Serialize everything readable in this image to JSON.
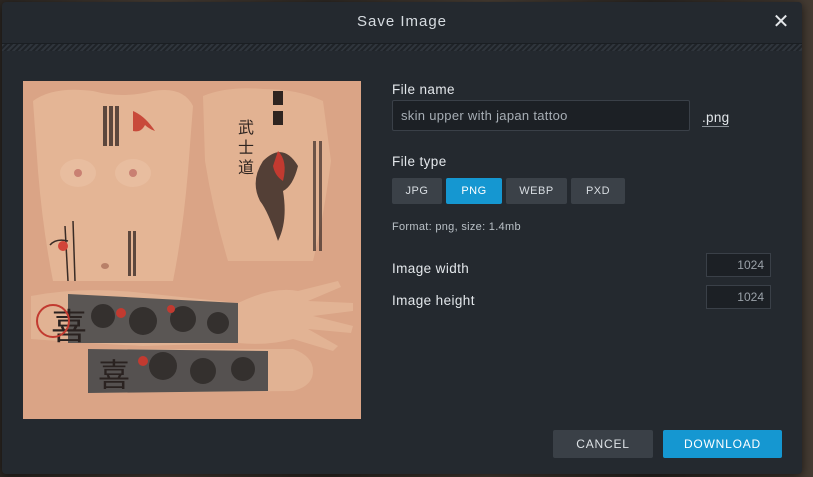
{
  "dialog": {
    "title": "Save Image",
    "close_icon": "close-icon"
  },
  "file_name": {
    "label": "File name",
    "value": "skin upper with japan tattoo",
    "extension": ".png"
  },
  "file_type": {
    "label": "File type",
    "options": [
      "JPG",
      "PNG",
      "WEBP",
      "PXD"
    ],
    "selected": "PNG"
  },
  "format_info": "Format: png, size: 1.4mb",
  "image_width": {
    "label": "Image width",
    "value": "1024"
  },
  "image_height": {
    "label": "Image height",
    "value": "1024"
  },
  "buttons": {
    "cancel": "CANCEL",
    "download": "DOWNLOAD"
  },
  "preview": {
    "calligraphy": [
      "武",
      "士",
      "道",
      "喜",
      "喜"
    ]
  },
  "colors": {
    "accent": "#1597d1",
    "dialog_bg": "#24292f",
    "skin": "#d9a485"
  }
}
